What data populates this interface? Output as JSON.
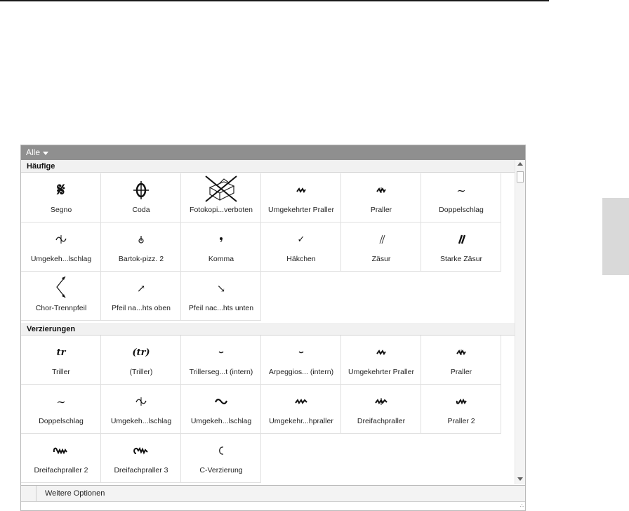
{
  "filter": {
    "label": "Alle",
    "icon": "chevron-down-icon"
  },
  "sections": [
    {
      "title": "Häufige",
      "items": [
        {
          "label": "Segno",
          "glyph": "𝄋",
          "icon": "segno-icon"
        },
        {
          "label": "Coda",
          "glyph": "𝄌",
          "icon": "coda-icon"
        },
        {
          "label": "Fotokopi...verboten",
          "glyph": "",
          "icon": "no-photocopy-icon"
        },
        {
          "label": "Umgekehrter Praller",
          "glyph": "𝆗",
          "icon": "inverted-mordent-icon"
        },
        {
          "label": "Praller",
          "glyph": "𝆗",
          "icon": "mordent-icon"
        },
        {
          "label": "Doppelschlag",
          "glyph": "∼",
          "icon": "turn-icon"
        },
        {
          "label": "Umgekeh...lschlag",
          "glyph": "∽",
          "icon": "inverted-turn-icon"
        },
        {
          "label": "Bartok-pizz. 2",
          "glyph": "ȯ",
          "icon": "bartok-pizz-icon"
        },
        {
          "label": "Komma",
          "glyph": "•",
          "icon": "comma-icon"
        },
        {
          "label": "Häkchen",
          "glyph": "✓",
          "icon": "tick-icon"
        },
        {
          "label": "Zäsur",
          "glyph": "//",
          "icon": "caesura-icon"
        },
        {
          "label": "Starke Zäsur",
          "glyph": "//",
          "icon": "strong-caesura-icon"
        },
        {
          "label": "Chor-Trennpfeil",
          "glyph": "",
          "icon": "choir-divider-arrow-icon"
        },
        {
          "label": "Pfeil na...hts oben",
          "glyph": "↗",
          "icon": "arrow-up-right-icon"
        },
        {
          "label": "Pfeil nac...hts unten",
          "glyph": "↘",
          "icon": "arrow-down-right-icon"
        }
      ]
    },
    {
      "title": "Verzierungen",
      "items": [
        {
          "label": "Triller",
          "glyph": "tr",
          "icon": "trill-icon"
        },
        {
          "label": "(Triller)",
          "glyph": "(tr)",
          "icon": "trill-parenthesized-icon"
        },
        {
          "label": "Trillerseg...t (intern)",
          "glyph": "‿",
          "icon": "trill-segment-icon"
        },
        {
          "label": "Arpeggios... (intern)",
          "glyph": "‿",
          "icon": "arpeggio-segment-icon"
        },
        {
          "label": "Umgekehrter Praller",
          "glyph": "𝆗",
          "icon": "inverted-mordent-icon"
        },
        {
          "label": "Praller",
          "glyph": "𝆗",
          "icon": "mordent-icon"
        },
        {
          "label": "Doppelschlag",
          "glyph": "∼",
          "icon": "turn-icon"
        },
        {
          "label": "Umgekeh...lschlag",
          "glyph": "∽",
          "icon": "inverted-turn-icon"
        },
        {
          "label": "Umgekeh...lschlag",
          "glyph": "∽",
          "icon": "inverted-turn-slash-icon"
        },
        {
          "label": "Umgekehr...hpraller",
          "glyph": "𝆗",
          "icon": "inverted-triple-mordent-icon"
        },
        {
          "label": "Dreifachpraller",
          "glyph": "𝆗",
          "icon": "triple-mordent-icon"
        },
        {
          "label": "Praller 2",
          "glyph": "𝆗",
          "icon": "mordent-2-icon"
        },
        {
          "label": "Dreifachpraller 2",
          "glyph": "𝆗",
          "icon": "triple-mordent-2-icon"
        },
        {
          "label": "Dreifachpraller 3",
          "glyph": "𝆗",
          "icon": "triple-mordent-3-icon"
        },
        {
          "label": "C-Verzierung",
          "glyph": "c",
          "icon": "c-ornament-icon"
        }
      ]
    }
  ],
  "options": {
    "label": "Weitere Optionen"
  },
  "colors": {
    "header": "#8f8f8f",
    "section": "#f1f1f1",
    "grid": "#e0e0e0"
  }
}
